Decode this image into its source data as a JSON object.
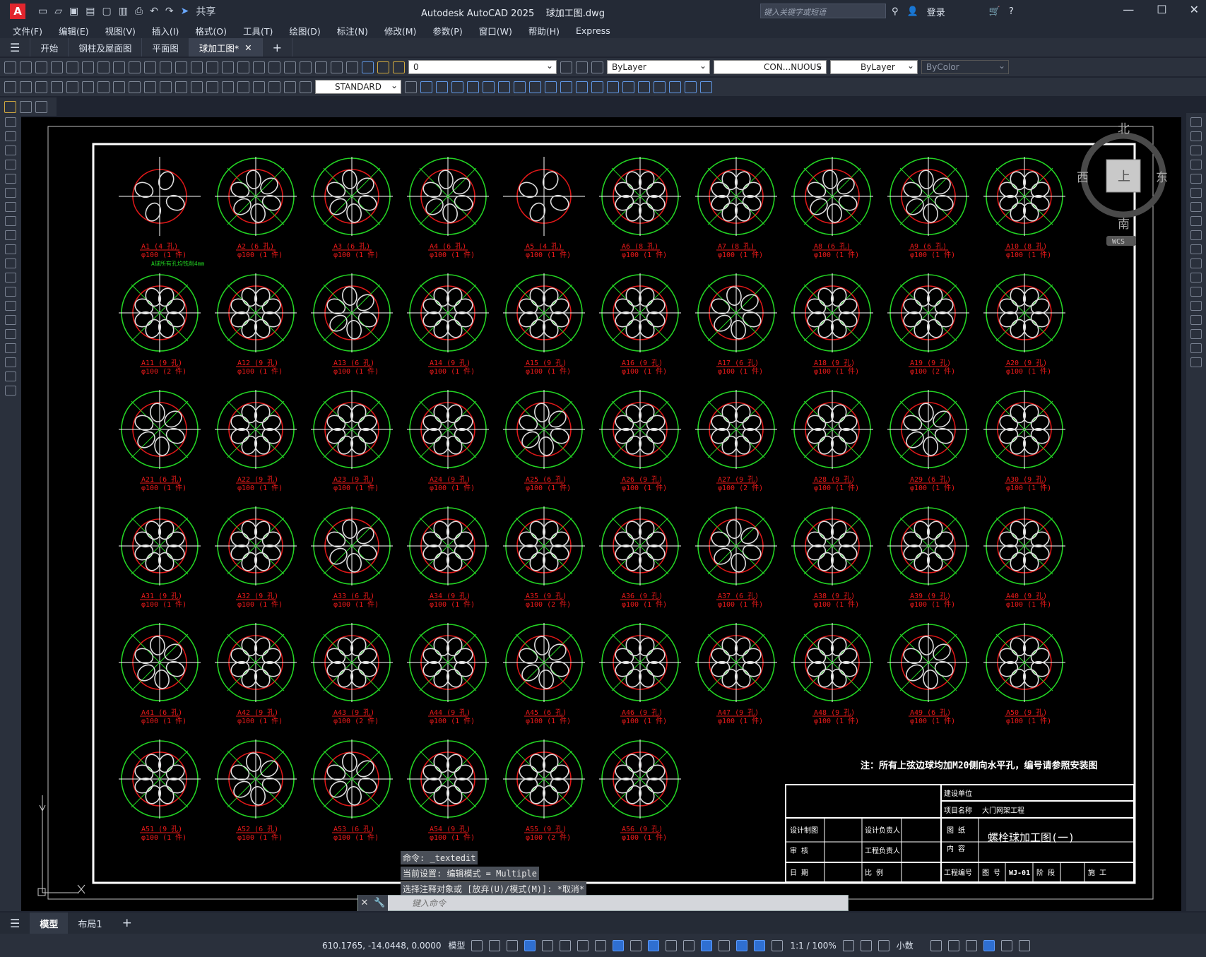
{
  "title": {
    "app": "Autodesk AutoCAD 2025",
    "file": "球加工图.dwg",
    "search_placeholder": "键入关键字或短语",
    "login": "登录",
    "share": "共享"
  },
  "menu": [
    "文件(F)",
    "编辑(E)",
    "视图(V)",
    "插入(I)",
    "格式(O)",
    "工具(T)",
    "绘图(D)",
    "标注(N)",
    "修改(M)",
    "参数(P)",
    "窗口(W)",
    "帮助(H)",
    "Express"
  ],
  "tabs": [
    {
      "label": "开始"
    },
    {
      "label": "钢柱及屋面图"
    },
    {
      "label": "平面图"
    },
    {
      "label": "球加工图*"
    }
  ],
  "toolbar": {
    "layer": "0",
    "color": "ByLayer",
    "linetype": "CON...NUOUS",
    "lineweight": "ByLayer",
    "plotstyle": "ByColor",
    "textstyle": "STANDARD"
  },
  "viewcube": {
    "n": "北",
    "s": "南",
    "e": "东",
    "w": "西",
    "top": "上",
    "wcs": "WCS"
  },
  "balls": [
    [
      "A1 (4 孔)",
      "φ100 (1 件)"
    ],
    [
      "A2 (6 孔)",
      "φ100 (1 件)"
    ],
    [
      "A3 (6 孔)",
      "φ100 (1 件)"
    ],
    [
      "A4 (6 孔)",
      "φ100 (1 件)"
    ],
    [
      "A5 (4 孔)",
      "φ100 (1 件)"
    ],
    [
      "A6 (8 孔)",
      "φ100 (1 件)"
    ],
    [
      "A7 (8 孔)",
      "φ100 (1 件)"
    ],
    [
      "A8 (6 孔)",
      "φ100 (1 件)"
    ],
    [
      "A9 (6 孔)",
      "φ100 (1 件)"
    ],
    [
      "A10 (8 孔)",
      "φ100 (1 件)"
    ],
    [
      "A11 (9 孔)",
      "φ100 (2 件)"
    ],
    [
      "A12 (9 孔)",
      "φ100 (1 件)"
    ],
    [
      "A13 (6 孔)",
      "φ100 (1 件)"
    ],
    [
      "A14 (9 孔)",
      "φ100 (1 件)"
    ],
    [
      "A15 (9 孔)",
      "φ100 (1 件)"
    ],
    [
      "A16 (9 孔)",
      "φ100 (1 件)"
    ],
    [
      "A17 (6 孔)",
      "φ100 (1 件)"
    ],
    [
      "A18 (9 孔)",
      "φ100 (1 件)"
    ],
    [
      "A19 (9 孔)",
      "φ100 (2 件)"
    ],
    [
      "A20 (9 孔)",
      "φ100 (1 件)"
    ],
    [
      "A21 (6 孔)",
      "φ100 (1 件)"
    ],
    [
      "A22 (9 孔)",
      "φ100 (1 件)"
    ],
    [
      "A23 (9 孔)",
      "φ100 (1 件)"
    ],
    [
      "A24 (9 孔)",
      "φ100 (1 件)"
    ],
    [
      "A25 (6 孔)",
      "φ100 (1 件)"
    ],
    [
      "A26 (9 孔)",
      "φ100 (1 件)"
    ],
    [
      "A27 (9 孔)",
      "φ100 (2 件)"
    ],
    [
      "A28 (9 孔)",
      "φ100 (1 件)"
    ],
    [
      "A29 (6 孔)",
      "φ100 (1 件)"
    ],
    [
      "A30 (9 孔)",
      "φ100 (1 件)"
    ],
    [
      "A31 (9 孔)",
      "φ100 (1 件)"
    ],
    [
      "A32 (9 孔)",
      "φ100 (1 件)"
    ],
    [
      "A33 (6 孔)",
      "φ100 (1 件)"
    ],
    [
      "A34 (9 孔)",
      "φ100 (1 件)"
    ],
    [
      "A35 (9 孔)",
      "φ100 (2 件)"
    ],
    [
      "A36 (9 孔)",
      "φ100 (1 件)"
    ],
    [
      "A37 (6 孔)",
      "φ100 (1 件)"
    ],
    [
      "A38 (9 孔)",
      "φ100 (1 件)"
    ],
    [
      "A39 (9 孔)",
      "φ100 (1 件)"
    ],
    [
      "A40 (9 孔)",
      "φ100 (1 件)"
    ],
    [
      "A41 (6 孔)",
      "φ100 (1 件)"
    ],
    [
      "A42 (9 孔)",
      "φ100 (1 件)"
    ],
    [
      "A43 (9 孔)",
      "φ100 (2 件)"
    ],
    [
      "A44 (9 孔)",
      "φ100 (1 件)"
    ],
    [
      "A45 (6 孔)",
      "φ100 (1 件)"
    ],
    [
      "A46 (9 孔)",
      "φ100 (1 件)"
    ],
    [
      "A47 (9 孔)",
      "φ100 (1 件)"
    ],
    [
      "A48 (9 孔)",
      "φ100 (1 件)"
    ],
    [
      "A49 (6 孔)",
      "φ100 (1 件)"
    ],
    [
      "A50 (9 孔)",
      "φ100 (1 件)"
    ],
    [
      "A51 (9 孔)",
      "φ100 (1 件)"
    ],
    [
      "A52 (6 孔)",
      "φ100 (1 件)"
    ],
    [
      "A53 (6 孔)",
      "φ100 (1 件)"
    ],
    [
      "A54 (9 孔)",
      "φ100 (1 件)"
    ],
    [
      "A55 (9 孔)",
      "φ100 (2 件)"
    ],
    [
      "A56 (9 孔)",
      "φ100 (1 件)"
    ]
  ],
  "ball_note": "A球所有孔均铣削4mm",
  "drawing_note": "注：所有上弦边球均加M20侧向水平孔，编号请参照安装图",
  "titleblock": {
    "jianshe": "建设单位",
    "xiangmu": "项目名称",
    "xiangmu_val": "大门网架工程",
    "sheji": "设计制图",
    "sheji_fz": "设计负责人",
    "tuzhi": "图 纸",
    "neirong": "内 容",
    "title": "螺栓球加工图(一)",
    "shenhe": "审 核",
    "gongcheng_fz": "工程负责人",
    "riqi": "日 期",
    "bili": "比 例",
    "gcbh": "工程编号",
    "tuhao": "图 号",
    "tuhao_val": "WJ-01",
    "jieduan": "阶 段",
    "shigong": "施 工"
  },
  "command": {
    "hist1": "命令: _textedit",
    "hist2": "当前设置: 编辑模式 = Multiple",
    "hist3": "选择注释对象或 [放弃(U)/模式(M)]: *取消*",
    "placeholder": "键入命令"
  },
  "layouts": [
    "模型",
    "布局1"
  ],
  "status": {
    "coords": "610.1765, -14.0448, 0.0000",
    "model": "模型",
    "scale": "1:1 / 100%",
    "units": "小数"
  }
}
